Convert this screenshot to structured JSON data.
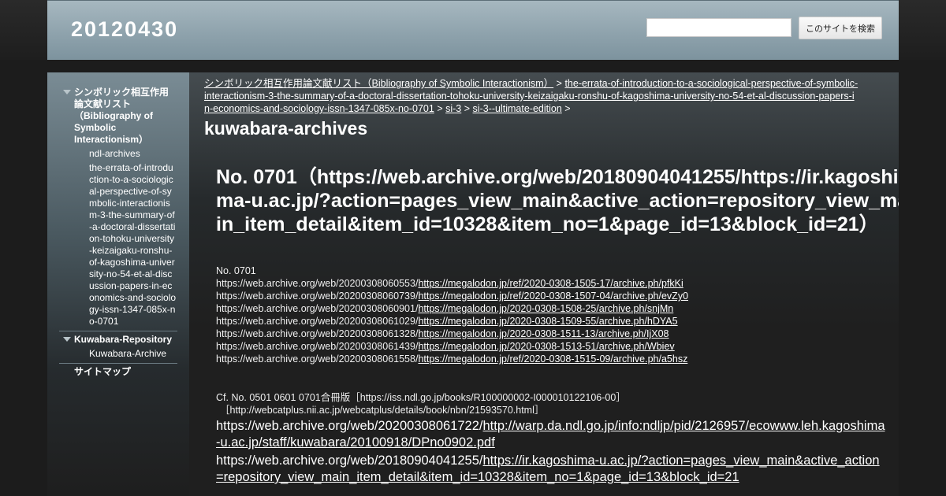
{
  "header": {
    "site_title": "20120430",
    "search_placeholder": "",
    "search_button": "このサイトを検索"
  },
  "sidebar": {
    "top_item_1": "シンボリック相互作用論文献リスト（Bibliography of Symbolic Interactionism）",
    "sub_1": "ndl-archives",
    "sub_2": "the-errata-of-introduction-to-a-sociological-perspective-of-symbolic-interactionism-3-the-summary-of-a-doctoral-dissertation-tohoku-university-keizaigaku-ronshu-of-kagoshima-university-no-54-et-al-discussion-papers-in-economics-and-sociology-issn-1347-085x-no-0701",
    "top_item_2": "Kuwabara-Repository",
    "sub_3": "Kuwabara-Archive",
    "top_item_3": "サイトマップ"
  },
  "breadcrumb": {
    "crumb_1": "シンボリック相互作用論文献リスト（Bibliography of Symbolic Interactionism）",
    "crumb_2": "the-errata-of-introduction-to-a-sociological-perspective-of-symbolic-interactionism-3-the-summary-of-a-doctoral-dissertation-tohoku-university-keizaigaku-ronshu-of-kagoshima-university-no-54-et-al-discussion-papers-in-economics-and-sociology-issn-1347-085x-no-0701",
    "crumb_3": "si-3",
    "crumb_4": "si-3--ultimate-edition",
    "separator": ">"
  },
  "main": {
    "page_title": "kuwabara-archives",
    "heading": "No. 0701（https://web.archive.org/web/20180904041255/https://ir.kagoshima-u.ac.jp/?action=pages_view_main&active_action=repository_view_main_item_detail&item_id=10328&item_no=1&page_id=13&block_id=21）",
    "no_label": "No. 0701",
    "archive_rows": [
      {
        "prefix": "https://web.archive.org/web/20200308060553/",
        "link": "https://megalodon.jp/ref/2020-0308-1505-17/archive.ph/pfkKi"
      },
      {
        "prefix": "https://web.archive.org/web/20200308060739/",
        "link": "https://megalodon.jp/ref/2020-0308-1507-04/archive.ph/evZy0"
      },
      {
        "prefix": "https://web.archive.org/web/20200308060901/",
        "link": "https://megalodon.jp/2020-0308-1508-25/archive.ph/snjMn"
      },
      {
        "prefix": "https://web.archive.org/web/20200308061029/",
        "link": "https://megalodon.jp/2020-0308-1509-55/archive.ph/hDYA5"
      },
      {
        "prefix": "https://web.archive.org/web/20200308061328/",
        "link": "https://megalodon.jp/2020-0308-1511-13/archive.ph/IjX08"
      },
      {
        "prefix": "https://web.archive.org/web/20200308061439/",
        "link": "https://megalodon.jp/2020-0308-1513-51/archive.ph/Wbiev"
      },
      {
        "prefix": "https://web.archive.org/web/20200308061558/",
        "link": "https://megalodon.jp/ref/2020-0308-1515-09/archive.ph/a5hsz"
      }
    ],
    "cf_line_1": "Cf. No. 0501 0601 0701合冊版［https://iss.ndl.go.jp/books/R100000002-I000010122106-00］",
    "cf_line_2": "［http://webcatplus.nii.ac.jp/webcatplus/details/book/nbn/21593570.html］",
    "large_1_prefix": "https://web.archive.org/web/20200308061722/",
    "large_1_link": "http://warp.da.ndl.go.jp/info:ndljp/pid/2126957/ecowww.leh.kagoshima-u.ac.jp/staff/kuwabara/20100918/DPno0902.pdf",
    "large_2_prefix": "https://web.archive.org/web/20180904041255/",
    "large_2_link": "https://ir.kagoshima-u.ac.jp/?action=pages_view_main&active_action=repository_view_main_item_detail&item_id=10328&item_no=1&page_id=13&block_id=21"
  }
}
